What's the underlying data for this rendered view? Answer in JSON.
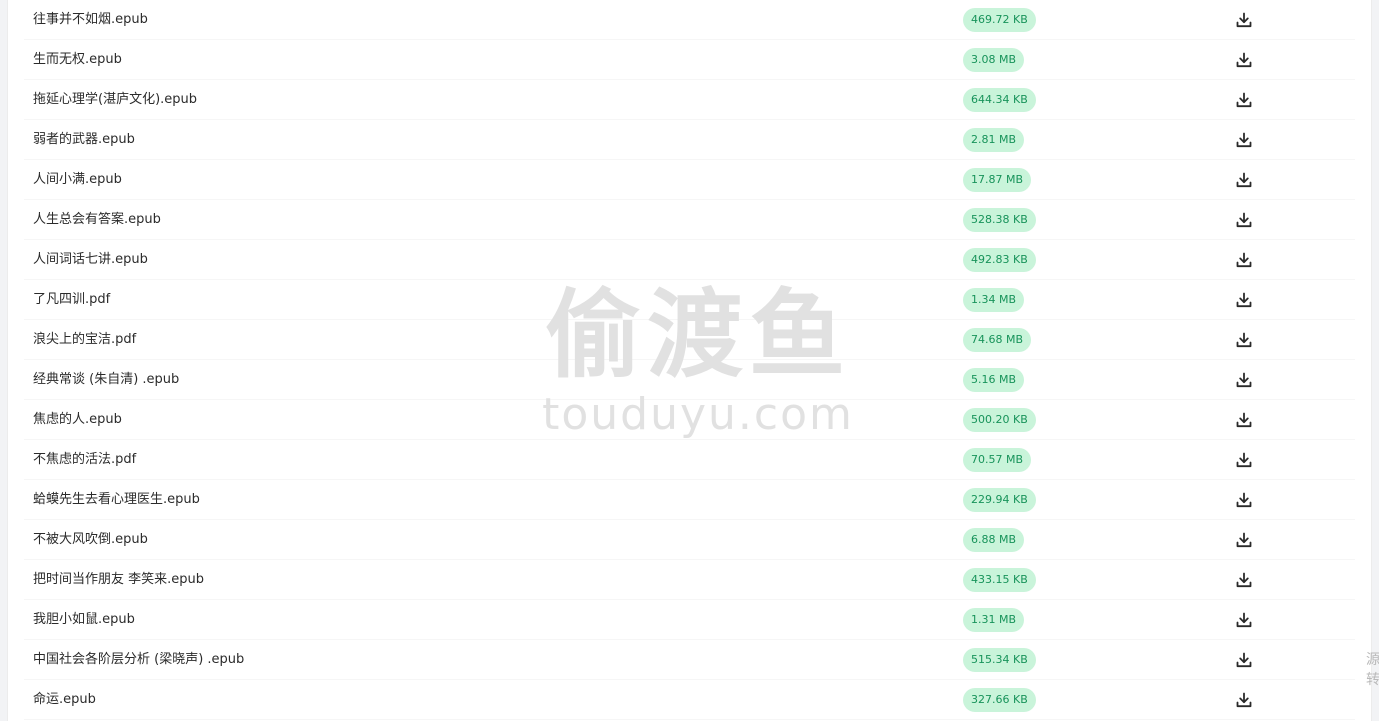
{
  "files": [
    {
      "name": "往事并不如烟.epub",
      "size": "469.72 KB"
    },
    {
      "name": "生而无权.epub",
      "size": "3.08 MB"
    },
    {
      "name": "拖延心理学(湛庐文化).epub",
      "size": "644.34 KB"
    },
    {
      "name": "弱者的武器.epub",
      "size": "2.81 MB"
    },
    {
      "name": "人间小满.epub",
      "size": "17.87 MB"
    },
    {
      "name": "人生总会有答案.epub",
      "size": "528.38 KB"
    },
    {
      "name": "人间词话七讲.epub",
      "size": "492.83 KB"
    },
    {
      "name": "了凡四训.pdf",
      "size": "1.34 MB"
    },
    {
      "name": "浪尖上的宝洁.pdf",
      "size": "74.68 MB"
    },
    {
      "name": "经典常谈 (朱自清) .epub",
      "size": "5.16 MB"
    },
    {
      "name": "焦虑的人.epub",
      "size": "500.20 KB"
    },
    {
      "name": "不焦虑的活法.pdf",
      "size": "70.57 MB"
    },
    {
      "name": "蛤蟆先生去看心理医生.epub",
      "size": "229.94 KB"
    },
    {
      "name": "不被大风吹倒.epub",
      "size": "6.88 MB"
    },
    {
      "name": "把时间当作朋友 李笑来.epub",
      "size": "433.15 KB"
    },
    {
      "name": "我胆小如鼠.epub",
      "size": "1.31 MB"
    },
    {
      "name": "中国社会各阶层分析 (梁晓声) .epub",
      "size": "515.34 KB"
    },
    {
      "name": "命运.epub",
      "size": "327.66 KB"
    }
  ],
  "row_action_icon": "download-icon",
  "watermark": {
    "cn": "偷渡鱼",
    "en": "touduyu.com"
  },
  "side_text": "源\n转",
  "colors": {
    "size_badge_bg": "#c9f4da",
    "size_badge_text": "#17935a",
    "watermark": "#e1e1e1"
  }
}
